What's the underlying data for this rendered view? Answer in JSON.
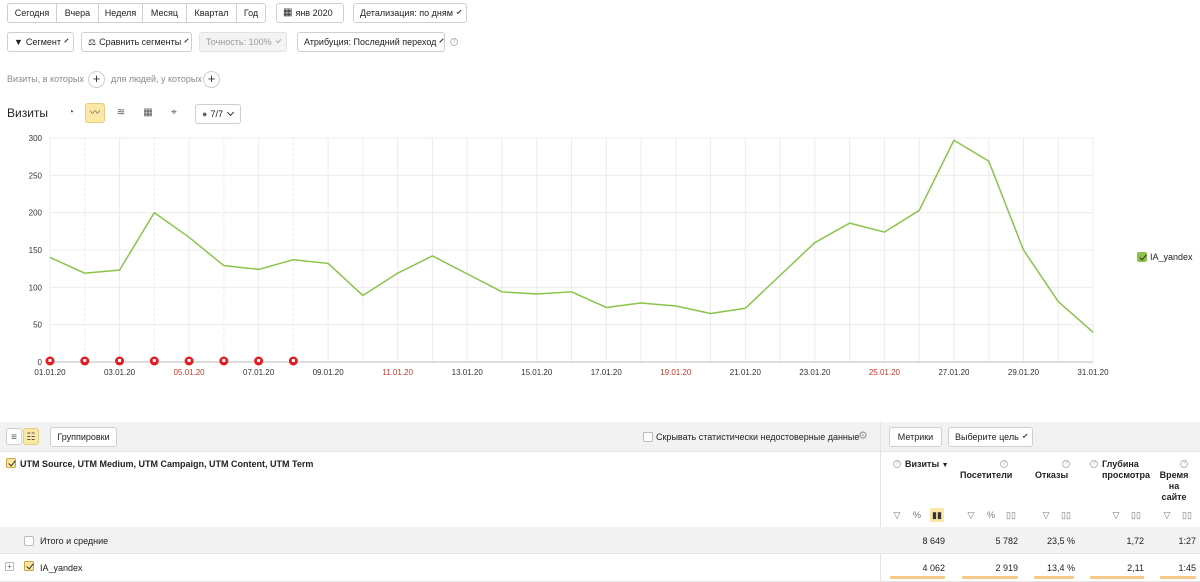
{
  "period_tabs": [
    "Сегодня",
    "Вчера",
    "Неделя",
    "Месяц",
    "Квартал",
    "Год"
  ],
  "date_button": "янв 2020",
  "detail_button": "Детализация: по дням",
  "segment_button": "Сегмент",
  "compare_button": "Сравнить сегменты",
  "accuracy_button": "Точность: 100%",
  "attribution_button": "Атрибуция: Последний переход",
  "filter_visits_label": "Визиты, в которых",
  "filter_people_label": "для людей, у которых",
  "chart_title": "Визиты",
  "annotations_button": "7/7",
  "legend_label": "IA_yandex",
  "colors": {
    "line": "#8bc34a",
    "accent": "#fbe7a6",
    "marker": "#e31b23",
    "weekend": "#c0392b"
  },
  "icons": [
    "pie-icon",
    "line-icon",
    "stack-icon",
    "grid-icon",
    "map-pin-icon",
    "comment-icon"
  ],
  "chart_data": {
    "type": "line",
    "title": "Визиты",
    "xlabel": "",
    "ylabel": "",
    "ylim": [
      0,
      300
    ],
    "yticks": [
      0,
      50,
      100,
      150,
      200,
      250,
      300
    ],
    "x": [
      "01.01.20",
      "02.01.20",
      "03.01.20",
      "04.01.20",
      "05.01.20",
      "06.01.20",
      "07.01.20",
      "08.01.20",
      "09.01.20",
      "10.01.20",
      "11.01.20",
      "12.01.20",
      "13.01.20",
      "14.01.20",
      "15.01.20",
      "16.01.20",
      "17.01.20",
      "18.01.20",
      "19.01.20",
      "20.01.20",
      "21.01.20",
      "22.01.20",
      "23.01.20",
      "24.01.20",
      "25.01.20",
      "26.01.20",
      "27.01.20",
      "28.01.20",
      "29.01.20",
      "30.01.20",
      "31.01.20"
    ],
    "xtick_labels": [
      "01.01.20",
      "03.01.20",
      "05.01.20",
      "07.01.20",
      "09.01.20",
      "11.01.20",
      "13.01.20",
      "15.01.20",
      "17.01.20",
      "19.01.20",
      "21.01.20",
      "23.01.20",
      "25.01.20",
      "27.01.20",
      "29.01.20",
      "31.01.20"
    ],
    "weekend_labels": [
      "05.01.20",
      "11.01.20",
      "19.01.20",
      "25.01.20"
    ],
    "series": [
      {
        "name": "IA_yandex",
        "values": [
          140,
          119,
          123,
          200,
          167,
          129,
          124,
          137,
          132,
          89,
          119,
          142,
          118,
          94,
          91,
          94,
          73,
          79,
          75,
          65,
          72,
          116,
          160,
          186,
          174,
          203,
          297,
          269,
          150,
          81,
          40
        ]
      }
    ],
    "annotation_days": [
      "01.01.20",
      "02.01.20",
      "03.01.20",
      "04.01.20",
      "05.01.20",
      "06.01.20",
      "07.01.20",
      "08.01.20"
    ],
    "grid": true,
    "legend": "right"
  },
  "table": {
    "groupings_button": "Группировки",
    "hide_unreliable_label": "Скрывать статистически недостоверные данные",
    "metrics_button": "Метрики",
    "goal_button": "Выберите цель",
    "dimension_header": "UTM Source, UTM Medium, UTM Campaign, UTM Content, UTM Term",
    "columns": [
      {
        "label": "Визиты",
        "sort": "▼"
      },
      {
        "label": "Посетители"
      },
      {
        "label": "Отказы"
      },
      {
        "label": "Глубина просмотра"
      },
      {
        "label": "Время на сайте"
      }
    ],
    "total_row": {
      "label": "Итого и средние",
      "values": [
        "8 649",
        "5 782",
        "23,5 %",
        "1,72",
        "1:27"
      ]
    },
    "rows": [
      {
        "label": "IA_yandex",
        "values": [
          "4 062",
          "2 919",
          "13,4 %",
          "2,11",
          "1:45"
        ]
      }
    ]
  }
}
